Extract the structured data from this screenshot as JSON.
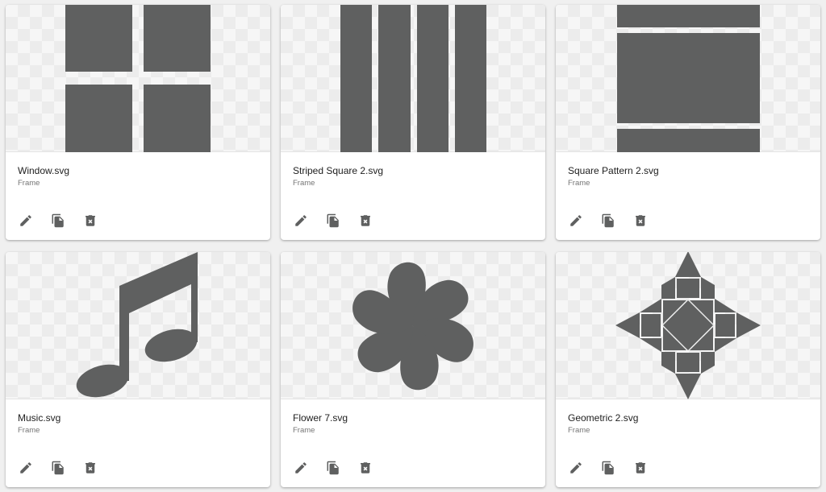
{
  "cards": [
    {
      "title": "Window.svg",
      "type": "Frame",
      "preview_icon": "window-shape-icon"
    },
    {
      "title": "Striped Square 2.svg",
      "type": "Frame",
      "preview_icon": "striped-square-shape-icon"
    },
    {
      "title": "Square Pattern 2.svg",
      "type": "Frame",
      "preview_icon": "square-pattern-shape-icon"
    },
    {
      "title": "Music.svg",
      "type": "Frame",
      "preview_icon": "music-note-shape-icon"
    },
    {
      "title": "Flower 7.svg",
      "type": "Frame",
      "preview_icon": "flower-shape-icon"
    },
    {
      "title": "Geometric 2.svg",
      "type": "Frame",
      "preview_icon": "geometric-star-shape-icon"
    }
  ],
  "actions": {
    "edit_icon": "pencil-icon",
    "duplicate_icon": "copy-icon",
    "delete_icon": "trash-icon"
  },
  "colors": {
    "shape_fill": "#5f6060",
    "card_background": "#ffffff",
    "page_background": "#f0f0f0"
  }
}
